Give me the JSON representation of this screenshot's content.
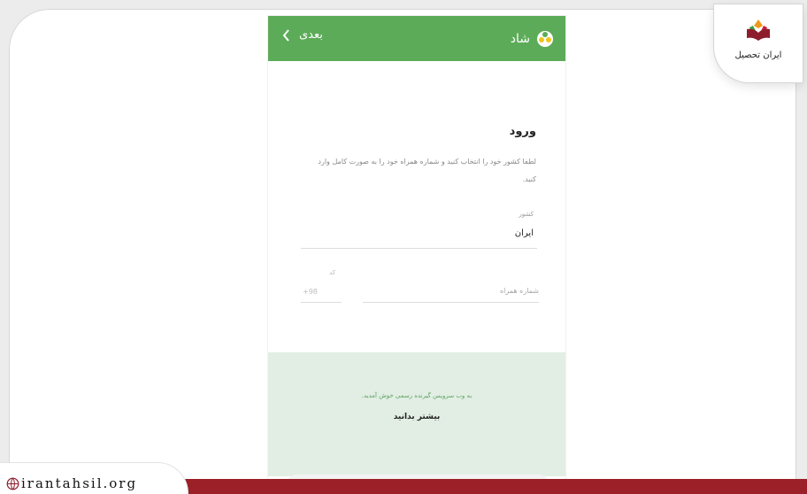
{
  "header": {
    "app_name": "شاد",
    "next_label": "بعدی"
  },
  "login": {
    "title": "ورود",
    "description": "لطفا کشور خود را انتخاب کنید و شماره همراه خود را به صورت کامل وارد کنید.",
    "country_label": "کشور",
    "country_value": "ایران",
    "country_code_label": "کد",
    "country_code": "+98",
    "phone_placeholder": "شماره همراه"
  },
  "banner": {
    "text": "به وب سرویس گیرنده رسمی خوش آمدید.",
    "link": "بیشتر بدانید"
  },
  "branding": {
    "logo_text": "ایران تحصیل",
    "site_url": "irantahsil.org"
  },
  "colors": {
    "header_green": "#5cab58",
    "banner_green": "#e2eee3",
    "accent_red": "#9b2028"
  },
  "icons": {
    "back": "chevron-left-icon",
    "logo": "shad-logo-icon",
    "share": "share-icon",
    "globe": "globe-icon"
  }
}
